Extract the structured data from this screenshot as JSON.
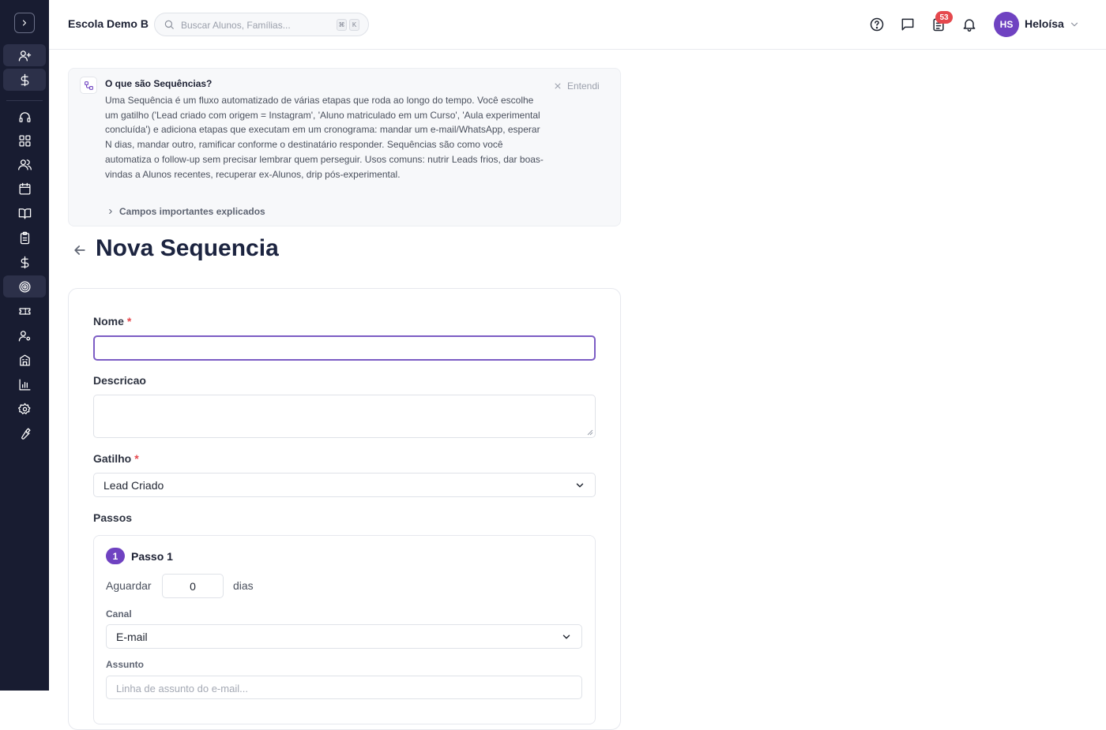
{
  "header": {
    "school_name": "Escola Demo B",
    "search_placeholder": "Buscar Alunos, Famílias...",
    "shortcut_keys": [
      "⌘",
      "K"
    ],
    "tasks_badge": "53",
    "user_initials": "HS",
    "user_name": "Heloísa"
  },
  "sidebar": {
    "items": [
      "user-plus",
      "dollar",
      "headset",
      "dashboard",
      "users",
      "calendar",
      "book",
      "clipboard",
      "dollar",
      "target",
      "ticket",
      "user-settings",
      "building",
      "chart",
      "settings",
      "wrench"
    ]
  },
  "info": {
    "title": "O que são Sequências?",
    "body": "Uma Sequência é um fluxo automatizado de várias etapas que roda ao longo do tempo. Você escolhe um gatilho ('Lead criado com origem = Instagram', 'Aluno matriculado em um Curso', 'Aula experimental concluída') e adiciona etapas que executam em um cronograma: mandar um e-mail/WhatsApp, esperar N dias, mandar outro, ramificar conforme o destinatário responder. Sequências são como você automatiza o follow-up sem precisar lembrar quem perseguir. Usos comuns: nutrir Leads frios, dar boas-vindas a Alunos recentes, recuperar ex-Alunos, drip pós-experimental.",
    "dismiss_label": "Entendi",
    "fields_link": "Campos importantes explicados"
  },
  "page": {
    "title": "Nova Sequencia"
  },
  "form": {
    "name_label": "Nome",
    "name_value": "",
    "required_mark": "*",
    "description_label": "Descricao",
    "trigger_label": "Gatilho",
    "trigger_value": "Lead Criado",
    "steps_label": "Passos",
    "step": {
      "number": "1",
      "title": "Passo 1",
      "wait_label": "Aguardar",
      "wait_value": "0",
      "days_label": "dias",
      "channel_label": "Canal",
      "channel_value": "E-mail",
      "subject_label": "Assunto",
      "subject_placeholder": "Linha de assunto do e-mail..."
    }
  },
  "colors": {
    "sidebar_bg": "#181c31",
    "accent": "#6f42c1",
    "badge": "#e5484d"
  }
}
